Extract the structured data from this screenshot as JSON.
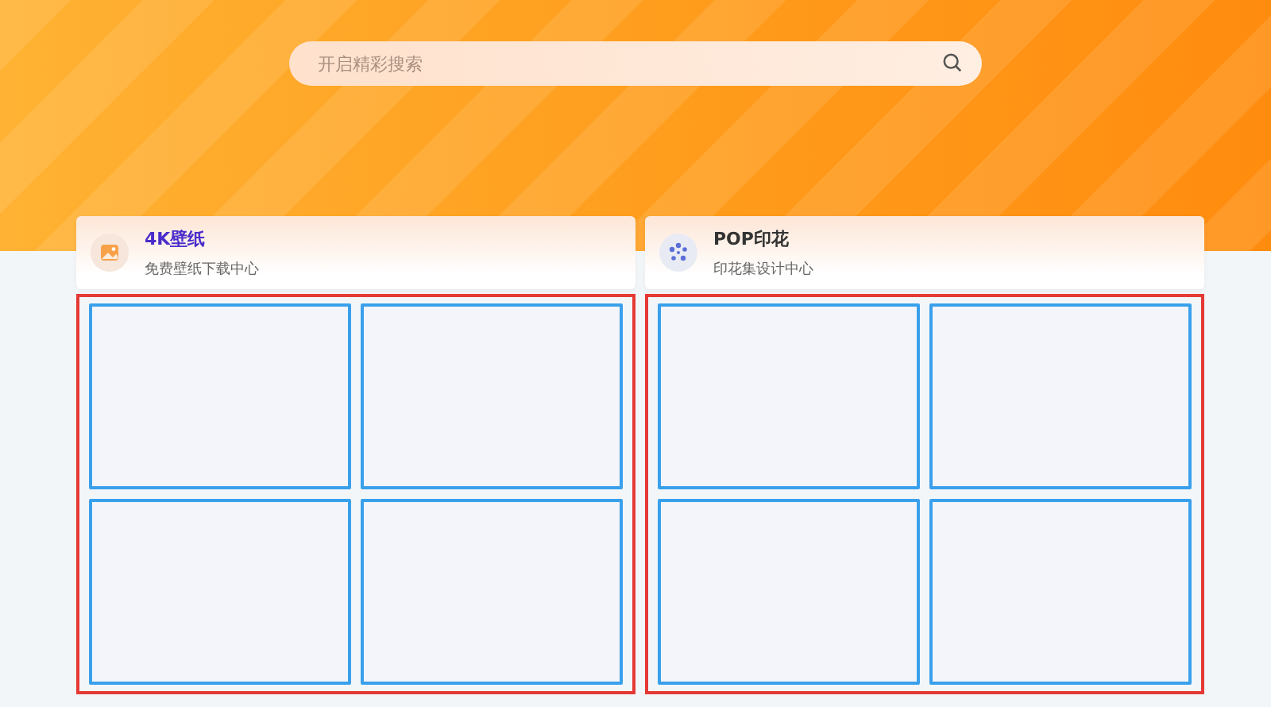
{
  "search": {
    "placeholder": "开启精彩搜索"
  },
  "cards": [
    {
      "title": "4K壁纸",
      "subtitle": "免费壁纸下载中心",
      "kind": "wallpaper",
      "selected": true
    },
    {
      "title": "POP印花",
      "subtitle": "印花集设计中心",
      "kind": "print",
      "selected": false
    }
  ]
}
